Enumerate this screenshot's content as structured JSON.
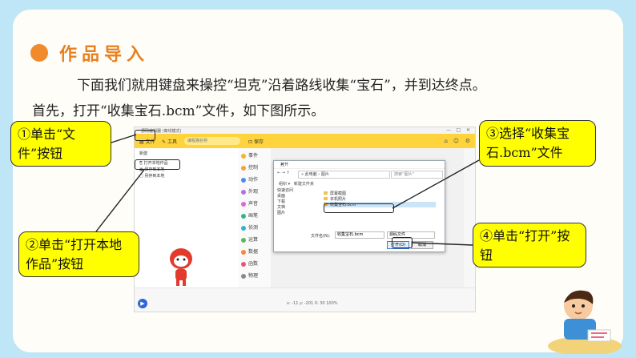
{
  "section": {
    "title": "作品导入",
    "line1": "下面我们就用键盘来操控“坦克”沿着路线收集“宝石”，并到达终点。",
    "line2": "首先，打开“收集宝石.bcm”文件，如下图所示。"
  },
  "app": {
    "window_title": "源码编辑器 (离线模式)",
    "toolbar": {
      "file": "文件",
      "tools": "工具",
      "project_placeholder": "编程猫名称",
      "save": "保存"
    },
    "file_menu": [
      "新建",
      "打开本地作品",
      "保存到本地",
      "另存到本地"
    ],
    "categories": [
      "事件",
      "控制",
      "动作",
      "外观",
      "声音",
      "画笔",
      "侦测",
      "运算",
      "数据",
      "函数",
      "物理"
    ],
    "coords": "x: -11   y: -201   0: 30   100%",
    "dialog": {
      "title": "打开",
      "path": "« 此电脑 › 图片",
      "search_placeholder": "搜索“图片”",
      "organize": "组织 ▾",
      "new_folder": "新建文件夹",
      "tree": [
        "快速访问",
        "桌面",
        "下载",
        "文档",
        "图片"
      ],
      "files": [
        "屏幕截图",
        "本机照片",
        "收集宝石.bcm"
      ],
      "filename_label": "文件名(N):",
      "filename_value": "收集宝石.bcm",
      "filetype_value": "源码文件",
      "open_button": "打开(O)",
      "cancel_button": "取消"
    }
  },
  "callouts": {
    "c1": "①单击“文件”按钮",
    "c2": "②单击“打开本地作品”按钮",
    "c3": "③选择“收集宝石.bcm”文件",
    "c4": "④单击“打开”按钮"
  },
  "colors": {
    "accent_orange": "#e8801f",
    "callout_yellow": "#ffff00",
    "toolbar_yellow": "#ffd33c"
  }
}
